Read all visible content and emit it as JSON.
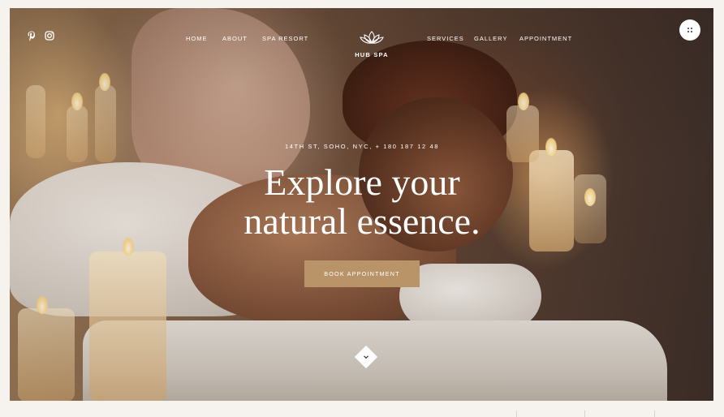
{
  "brand": {
    "name": "HUB SPA"
  },
  "nav": {
    "left": [
      {
        "label": "HOME"
      },
      {
        "label": "ABOUT"
      },
      {
        "label": "SPA RESORT"
      }
    ],
    "right": [
      {
        "label": "SERVICES"
      },
      {
        "label": "GALLERY"
      },
      {
        "label": "APPOINTMENT"
      }
    ]
  },
  "social": {
    "icons": [
      "pinterest-icon",
      "instagram-icon"
    ]
  },
  "menu_button": {
    "icon": "dots-grid-icon"
  },
  "hero": {
    "address": "14TH ST, SOHO, NYC, + 180 187 12 48",
    "headline_line1": "Explore your",
    "headline_line2": "natural essence.",
    "cta_label": "BOOK APPOINTMENT",
    "scroll_icon": "chevron-down-icon"
  },
  "colors": {
    "accent": "#b89468",
    "background": "#f6f3ef",
    "text_on_image": "#ffffff"
  }
}
